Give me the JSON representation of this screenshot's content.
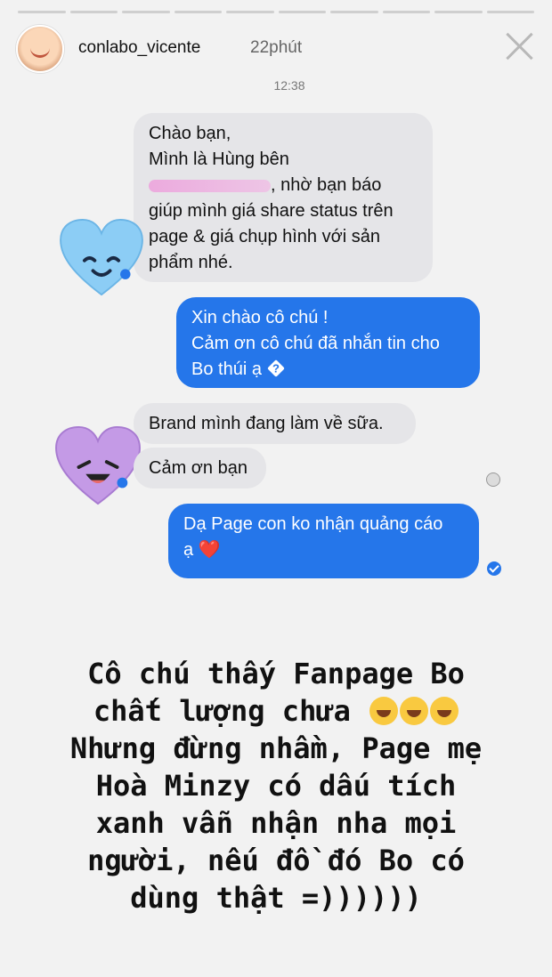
{
  "story": {
    "username": "conlabo_vicente",
    "time_ago": "22phút"
  },
  "chat": {
    "timestamp": "12:38",
    "incoming_1": {
      "line1": "Chào bạn,",
      "line2": "Mình là Hùng bên",
      "line3_after_redaction": ", nhờ bạn báo",
      "line4": "giúp mình giá share status trên",
      "line5": "page & giá chụp hình với sản",
      "line6": "phẩm nhé."
    },
    "outgoing_1": {
      "line1": "Xin chào cô chú !",
      "line2": "Cảm ơn cô chú đã nhắn tin cho",
      "line3": "Bo thúi ạ"
    },
    "incoming_2": "Brand mình đang làm về sữa.",
    "incoming_3": "Cảm ơn bạn",
    "outgoing_2": {
      "line1": "Dạ Page con ko nhận quảng cáo",
      "line2": "ạ",
      "emoji": "❤️"
    }
  },
  "caption": {
    "line1": "Cô chú thấy Fanpage Bo",
    "line2": "chất lượng chưa ",
    "line3": "Nhưng đừng nhầm, Page mẹ",
    "line4": "Hoà Minzy có dấu tích",
    "line5": "xanh vẫn nhận nha mọi",
    "line6": "người, nếu đồ đó Bo có",
    "line7": "dùng thật =))))))"
  },
  "icons": {
    "close": "close-icon",
    "heart_blue": "blue-heart-sticker-icon",
    "heart_purple": "purple-heart-sticker-icon",
    "laugh": "tears-of-joy-emoji-icon"
  },
  "colors": {
    "outgoing_bubble": "#2576ea",
    "incoming_bubble": "#e5e5e8",
    "background": "#f2f2f2"
  }
}
